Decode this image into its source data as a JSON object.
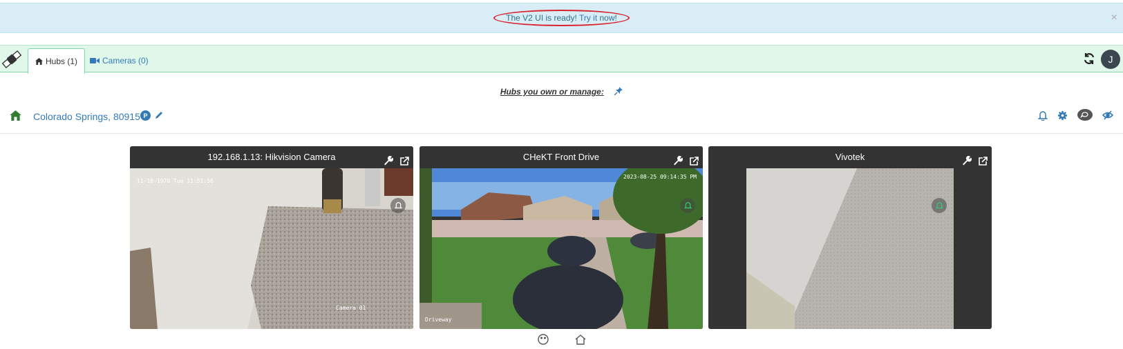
{
  "banner": {
    "text_before": "The V2 UI is ready! ",
    "link": "Try it",
    "text_after": " now!",
    "close": "×"
  },
  "nav": {
    "tabs": [
      {
        "label": "Hubs (1)",
        "icon": "home-icon"
      },
      {
        "label": "Cameras (0)",
        "icon": "video-camera-icon"
      }
    ],
    "avatar_initial": "J"
  },
  "subheading": "Hubs you own or manage:",
  "hub": {
    "name": "Colorado Springs, 80915",
    "badge": "P"
  },
  "cameras": [
    {
      "title": "192.168.1.13: Hikvision Camera",
      "timestamp": "11-10-1970 Tue 11:51:56",
      "label": "Camera 01"
    },
    {
      "title": "CHeKT Front Drive",
      "timestamp": "2023-08-25 09:14:35 PM",
      "label": "Driveway"
    },
    {
      "title": "Vivotek"
    }
  ],
  "colors": {
    "banner_bg": "#d9edf7",
    "nav_bg": "#dff8ea",
    "link": "#337ab7",
    "home_green": "#2e7d32",
    "oval_red": "#d9232e"
  }
}
